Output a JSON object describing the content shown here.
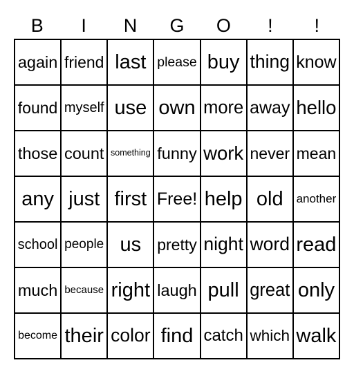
{
  "card": {
    "type": "bingo-card",
    "columns": 7,
    "rows": 7,
    "header": [
      "B",
      "I",
      "N",
      "G",
      "O",
      "!",
      "!"
    ],
    "free_space": "Free!",
    "colors": {
      "background": "#ffffff",
      "border": "#000000",
      "text": "#000000"
    },
    "grid": [
      [
        "again",
        "friend",
        "last",
        "please",
        "buy",
        "thing",
        "know"
      ],
      [
        "found",
        "myself",
        "use",
        "own",
        "more",
        "away",
        "hello"
      ],
      [
        "those",
        "count",
        "something",
        "funny",
        "work",
        "never",
        "mean"
      ],
      [
        "any",
        "just",
        "first",
        "Free!",
        "help",
        "old",
        "another"
      ],
      [
        "school",
        "people",
        "us",
        "pretty",
        "night",
        "word",
        "read"
      ],
      [
        "much",
        "because",
        "right",
        "laugh",
        "pull",
        "great",
        "only"
      ],
      [
        "become",
        "their",
        "color",
        "find",
        "catch",
        "which",
        "walk"
      ]
    ]
  }
}
